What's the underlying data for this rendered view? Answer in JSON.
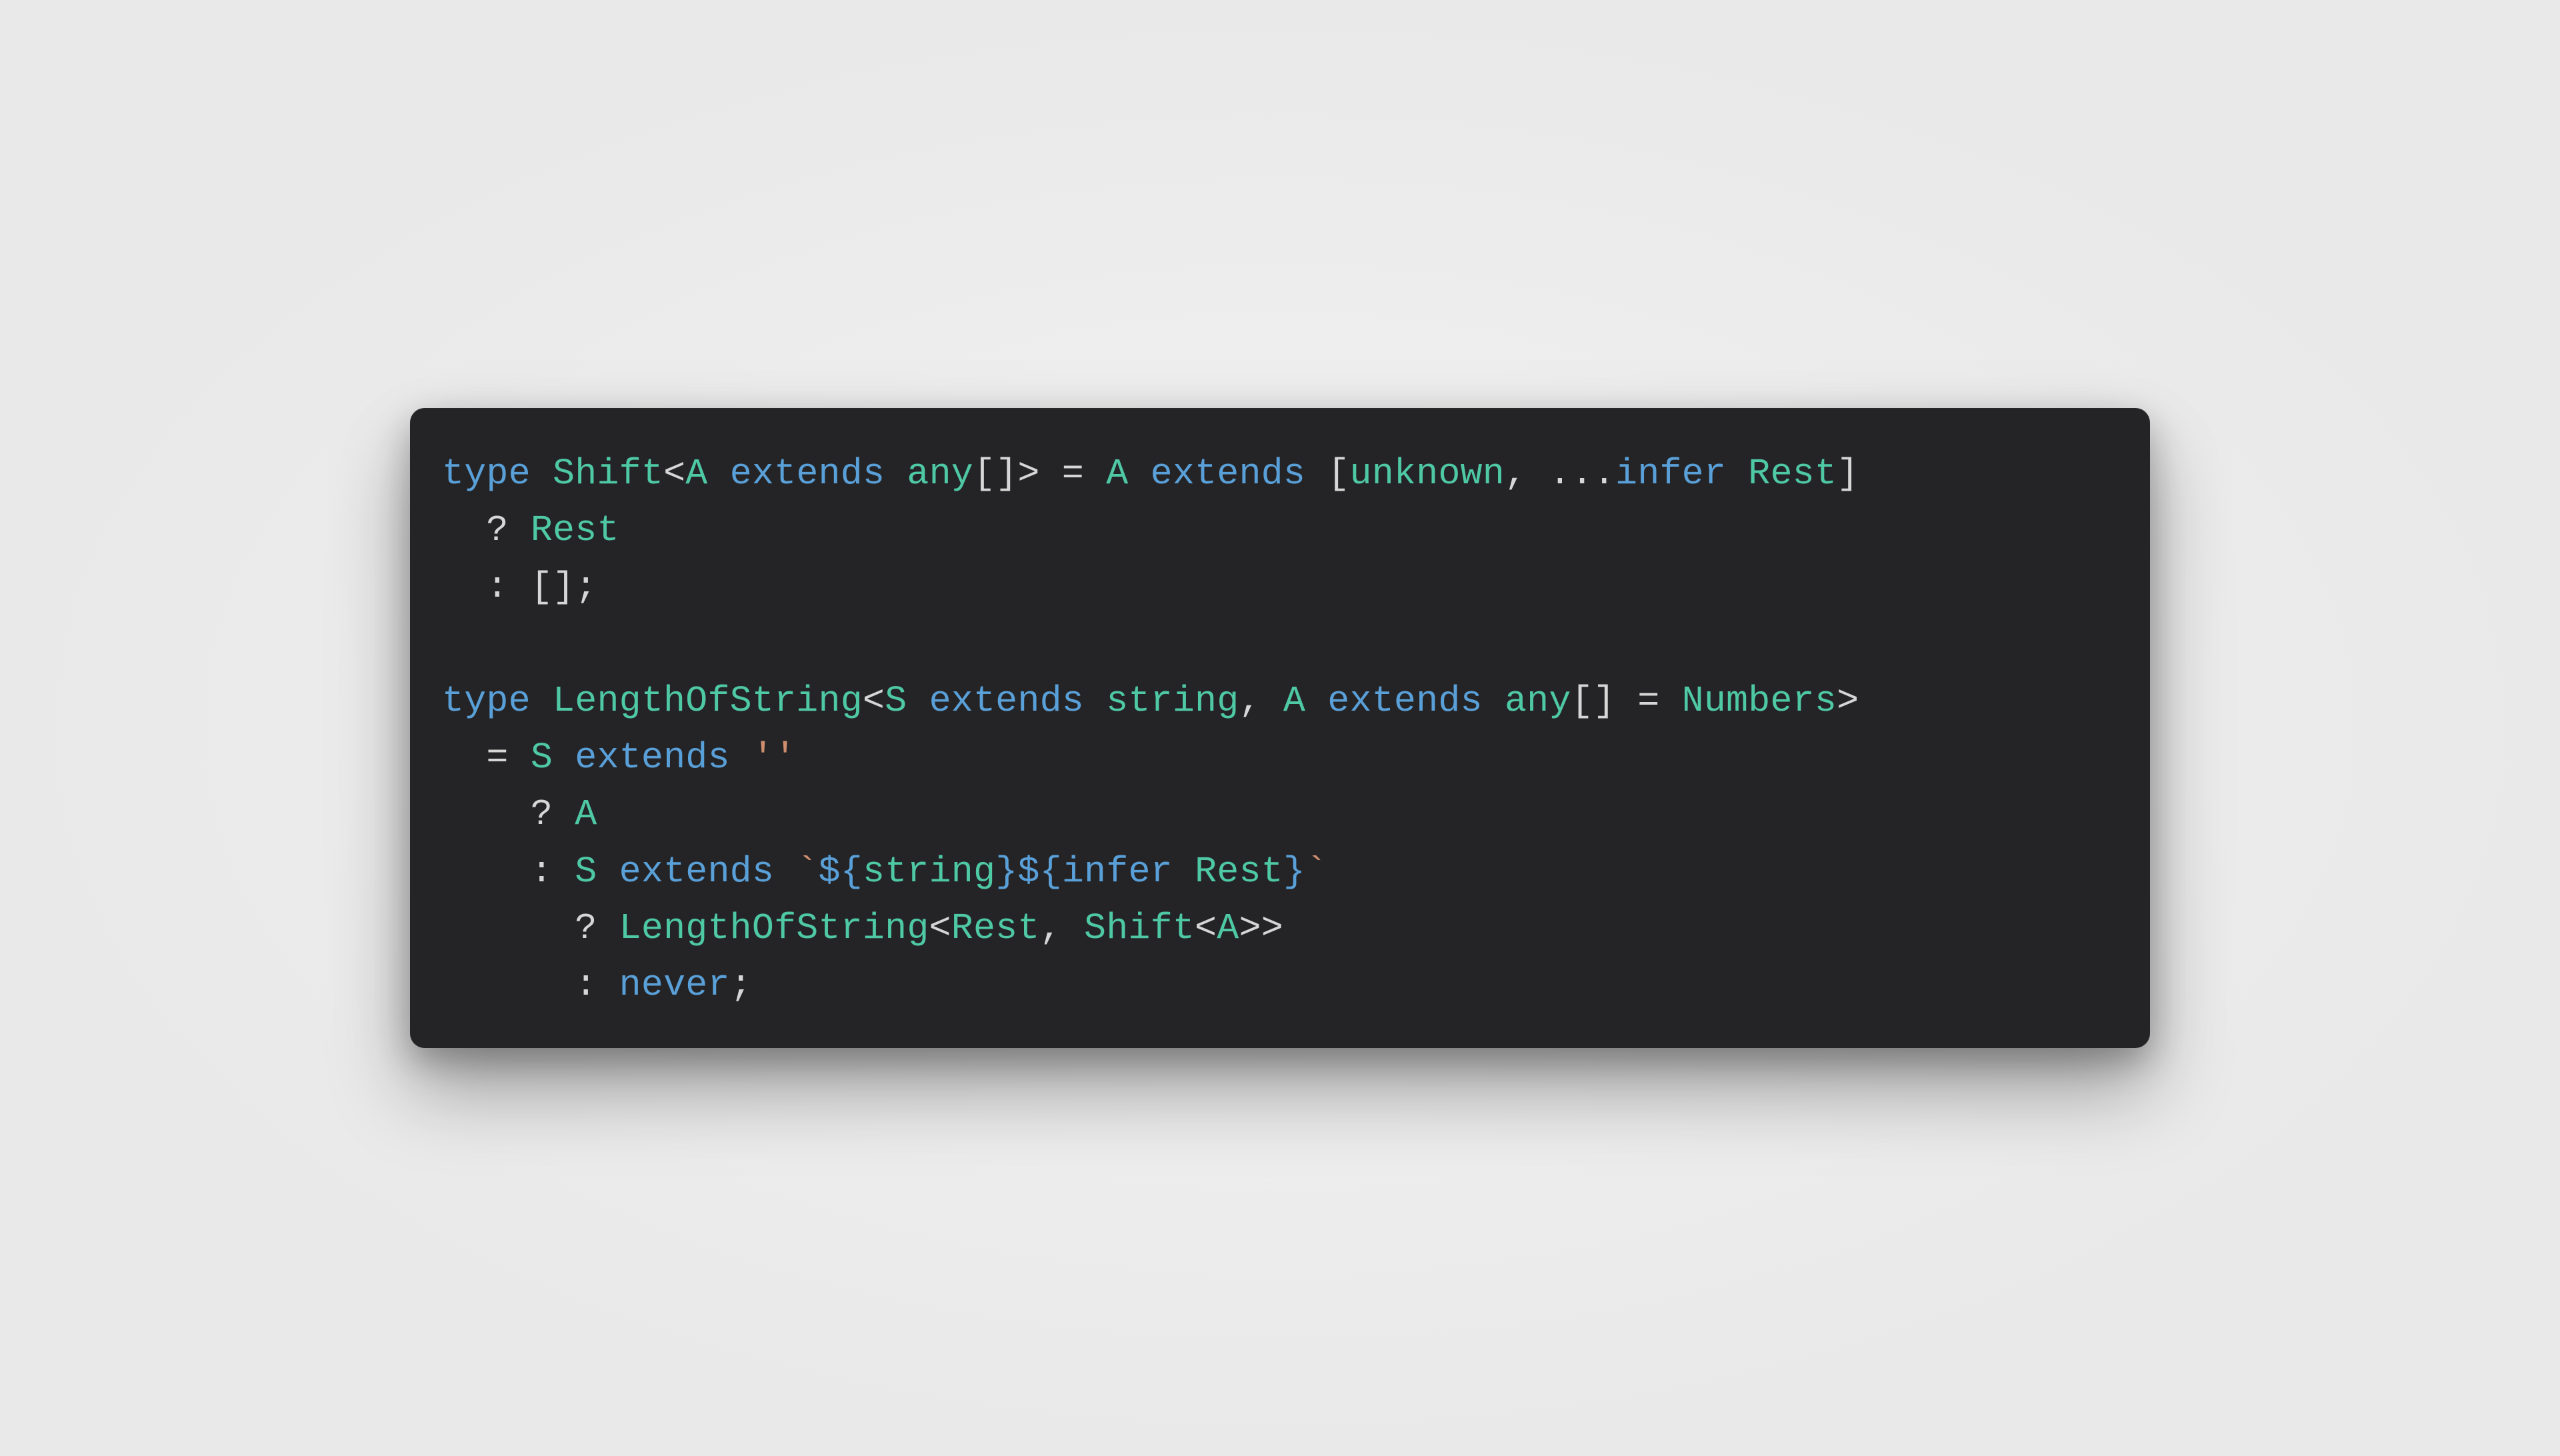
{
  "colors": {
    "background": "#242427",
    "keyword": "#5aa0d8",
    "type": "#4ec9a4",
    "punctuation": "#d6d6d6",
    "string": "#cf8e6d"
  },
  "code": {
    "lines": [
      [
        {
          "t": "type ",
          "c": "kw"
        },
        {
          "t": "Shift",
          "c": "type"
        },
        {
          "t": "<",
          "c": "punc"
        },
        {
          "t": "A",
          "c": "type"
        },
        {
          "t": " extends ",
          "c": "kw"
        },
        {
          "t": "any",
          "c": "prim"
        },
        {
          "t": "[]> = ",
          "c": "punc"
        },
        {
          "t": "A",
          "c": "type"
        },
        {
          "t": " extends ",
          "c": "kw"
        },
        {
          "t": "[",
          "c": "punc"
        },
        {
          "t": "unknown",
          "c": "unknown"
        },
        {
          "t": ", ...",
          "c": "punc"
        },
        {
          "t": "infer ",
          "c": "kw"
        },
        {
          "t": "Rest",
          "c": "type"
        },
        {
          "t": "]",
          "c": "punc"
        }
      ],
      [
        {
          "t": "  ? ",
          "c": "punc"
        },
        {
          "t": "Rest",
          "c": "type"
        }
      ],
      [
        {
          "t": "  : [];",
          "c": "punc"
        }
      ],
      [
        {
          "t": "",
          "c": "punc"
        }
      ],
      [
        {
          "t": "type ",
          "c": "kw"
        },
        {
          "t": "LengthOfString",
          "c": "type"
        },
        {
          "t": "<",
          "c": "punc"
        },
        {
          "t": "S",
          "c": "type"
        },
        {
          "t": " extends ",
          "c": "kw"
        },
        {
          "t": "string",
          "c": "prim"
        },
        {
          "t": ", ",
          "c": "punc"
        },
        {
          "t": "A",
          "c": "type"
        },
        {
          "t": " extends ",
          "c": "kw"
        },
        {
          "t": "any",
          "c": "prim"
        },
        {
          "t": "[] = ",
          "c": "punc"
        },
        {
          "t": "Numbers",
          "c": "type"
        },
        {
          "t": ">",
          "c": "punc"
        }
      ],
      [
        {
          "t": "  = ",
          "c": "punc"
        },
        {
          "t": "S",
          "c": "type"
        },
        {
          "t": " extends ",
          "c": "kw"
        },
        {
          "t": "''",
          "c": "str"
        }
      ],
      [
        {
          "t": "    ? ",
          "c": "punc"
        },
        {
          "t": "A",
          "c": "type"
        }
      ],
      [
        {
          "t": "    : ",
          "c": "punc"
        },
        {
          "t": "S",
          "c": "type"
        },
        {
          "t": " extends ",
          "c": "kw"
        },
        {
          "t": "`",
          "c": "str"
        },
        {
          "t": "${",
          "c": "kw"
        },
        {
          "t": "string",
          "c": "prim"
        },
        {
          "t": "}",
          "c": "kw"
        },
        {
          "t": "${",
          "c": "kw"
        },
        {
          "t": "infer ",
          "c": "kw"
        },
        {
          "t": "Rest",
          "c": "type"
        },
        {
          "t": "}",
          "c": "kw"
        },
        {
          "t": "`",
          "c": "str"
        }
      ],
      [
        {
          "t": "      ? ",
          "c": "punc"
        },
        {
          "t": "LengthOfString",
          "c": "type"
        },
        {
          "t": "<",
          "c": "punc"
        },
        {
          "t": "Rest",
          "c": "type"
        },
        {
          "t": ", ",
          "c": "punc"
        },
        {
          "t": "Shift",
          "c": "type"
        },
        {
          "t": "<",
          "c": "punc"
        },
        {
          "t": "A",
          "c": "type"
        },
        {
          "t": ">>",
          "c": "punc"
        }
      ],
      [
        {
          "t": "      : ",
          "c": "punc"
        },
        {
          "t": "never",
          "c": "never"
        },
        {
          "t": ";",
          "c": "punc"
        }
      ]
    ]
  }
}
